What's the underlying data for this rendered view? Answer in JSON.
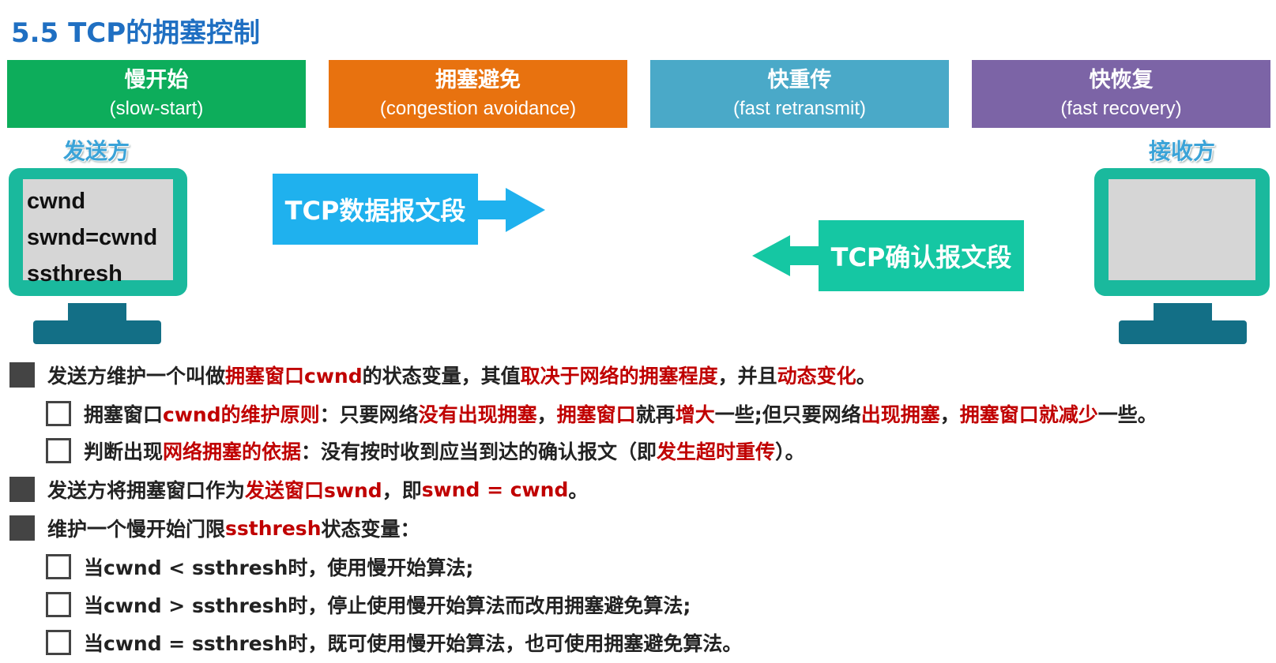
{
  "title": "5.5 TCP的拥塞控制",
  "phases": [
    {
      "cn": "慢开始",
      "en": "(slow-start)",
      "color": "#0dad5b"
    },
    {
      "cn": "拥塞避免",
      "en": "(congestion avoidance)",
      "color": "#e8720f"
    },
    {
      "cn": "快重传",
      "en": "(fast retransmit)",
      "color": "#4aa9c8"
    },
    {
      "cn": "快恢复",
      "en": "(fast recovery)",
      "color": "#7c64a6"
    }
  ],
  "sender": {
    "label": "发送方",
    "vars": [
      "cwnd",
      "swnd=cwnd",
      "ssthresh"
    ]
  },
  "receiver": {
    "label": "接收方"
  },
  "segments": {
    "data": "TCP数据报文段",
    "ack": "TCP确认报文段"
  },
  "bullets": {
    "b1": {
      "t1": "发送方维护一个叫做",
      "r1": "拥塞窗口cwnd",
      "t2": "的状态变量，其值",
      "r2": "取决于网络的拥塞程度",
      "t3": "，并且",
      "r3": "动态变化",
      "t4": "。"
    },
    "b1a": {
      "t1": "拥塞窗口",
      "r1": "cwnd的维护原则",
      "t2": "：只要网络",
      "r2": "没有出现拥塞",
      "t3": "，",
      "r3": "拥塞窗口",
      "t4": "就再",
      "r4": "增大",
      "t5": "一些;但只要网络",
      "r5": "出现拥塞",
      "t6": "，",
      "r6": "拥塞窗口就减少",
      "t7": "一些。"
    },
    "b1b": {
      "t1": "判断出现",
      "r1": "网络拥塞的依据",
      "t2": "：没有按时收到应当到达的确认报文（即",
      "r2": "发生超时重传",
      "t3": "）。"
    },
    "b2": {
      "t1": "发送方将拥塞窗口作为",
      "r1": "发送窗口swnd",
      "t2": "，即",
      "r2": "swnd = cwnd",
      "t3": "。"
    },
    "b3": {
      "t1": "维护一个慢开始门限",
      "r1": "ssthresh",
      "t2": "状态变量："
    },
    "b3a": "当cwnd < ssthresh时，使用慢开始算法;",
    "b3b": "当cwnd > ssthresh时，停止使用慢开始算法而改用拥塞避免算法;",
    "b3c": "当cwnd = ssthresh时，既可使用慢开始算法，也可使用拥塞避免算法。"
  }
}
